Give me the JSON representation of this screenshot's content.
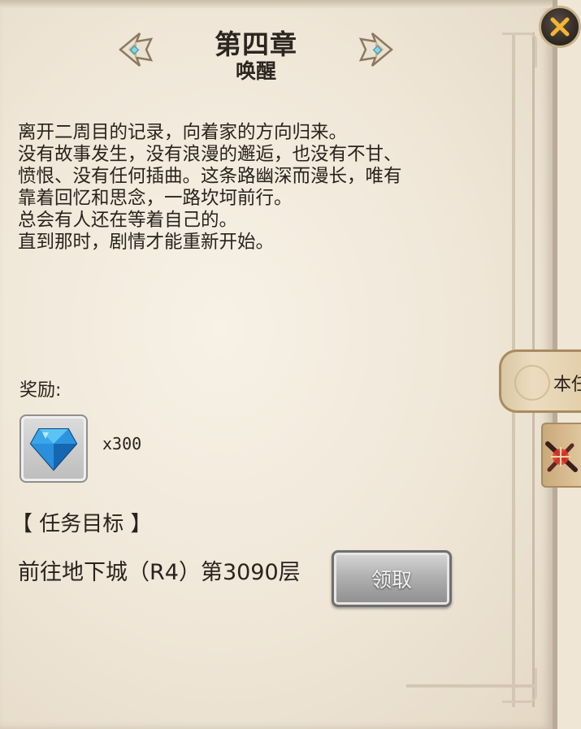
{
  "chapter": {
    "title": "第四章",
    "subtitle": "唤醒"
  },
  "story_text": "离开二周目的记录，向着家的方向归来。\n没有故事发生，没有浪漫的邂逅，也没有不甘、\n愤恨、没有任何插曲。这条路幽深而漫长，唯有\n靠着回忆和思念，一路坎坷前行。\n总会有人还在等着自己的。\n直到那时，剧情才能重新开始。",
  "reward": {
    "label": "奖励:",
    "item_icon": "blue-diamond-icon",
    "quantity": "x300"
  },
  "mission": {
    "header": "【 任务目标 】",
    "target": "前往地下城（R4）第3090层",
    "claim_label": "领取"
  },
  "side_tab": {
    "label": "本任"
  },
  "colors": {
    "parchment": "#efe6d6",
    "text": "#2a221c",
    "close_x": "#f2b632",
    "gem": "#2d9fe8"
  }
}
